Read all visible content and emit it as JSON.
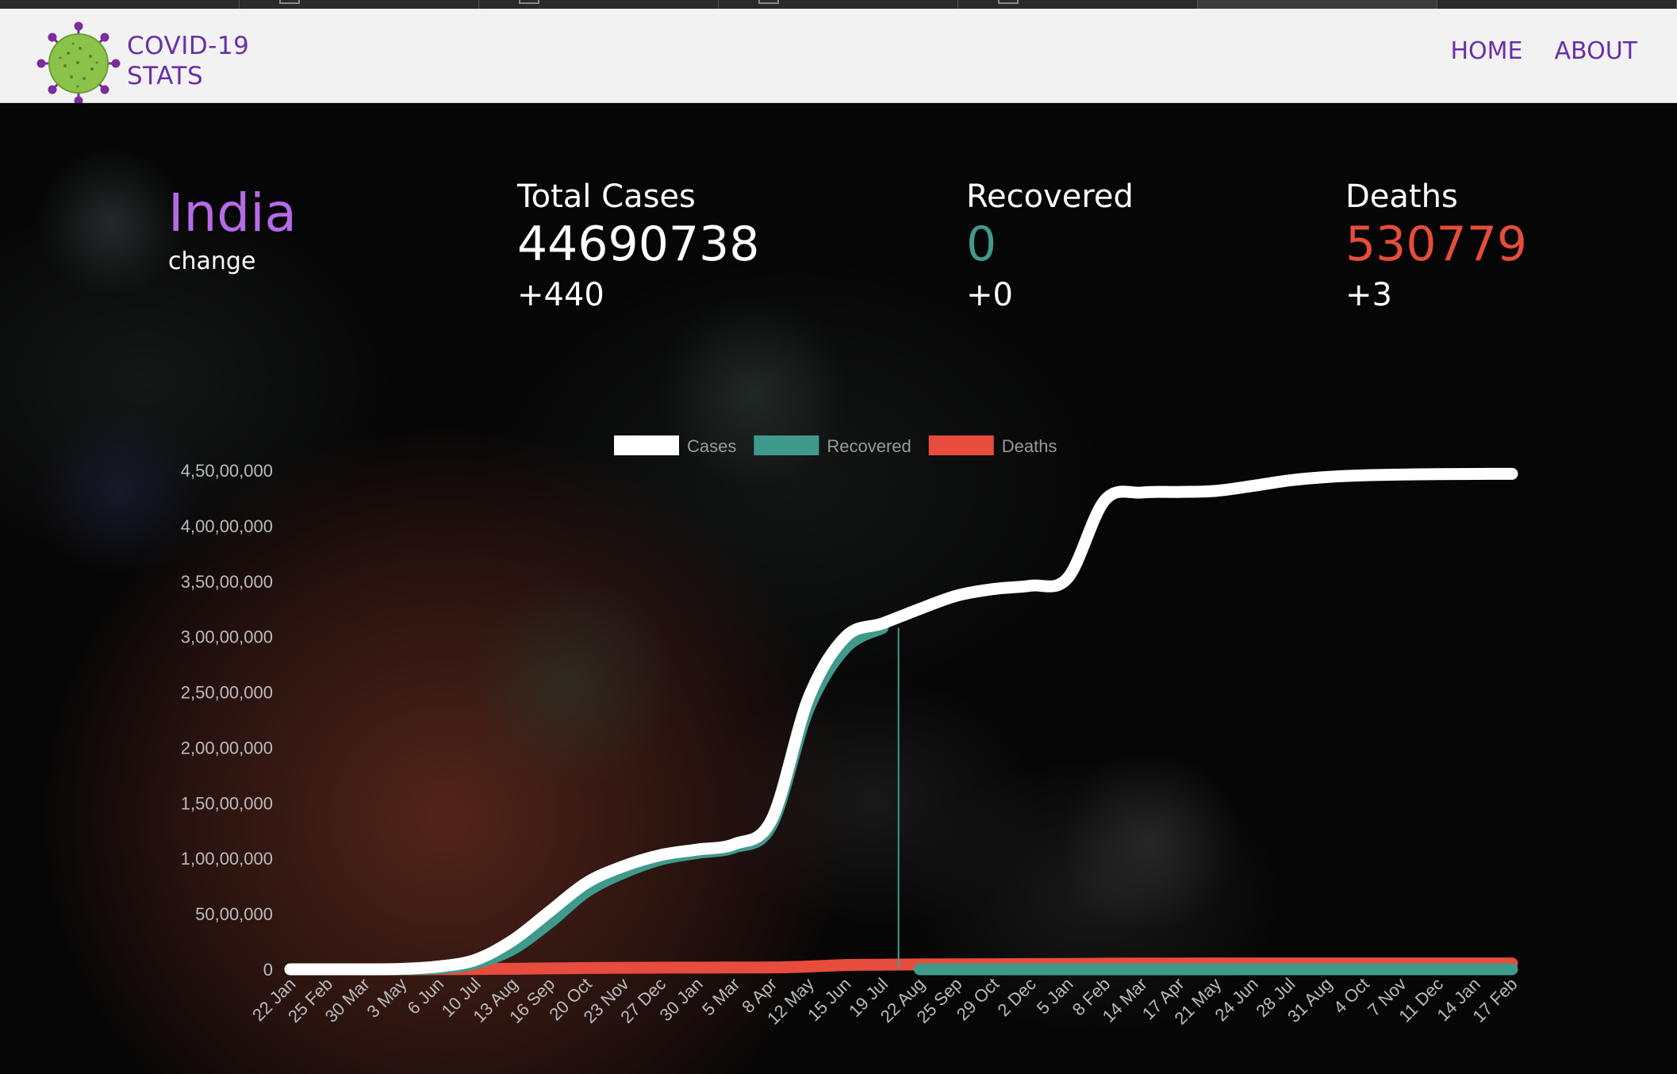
{
  "app": {
    "logo_line1": "COVID-19",
    "logo_line2": "STATS",
    "nav": {
      "home": "HOME",
      "about": "ABOUT"
    }
  },
  "country": {
    "name": "India",
    "change_label": "change"
  },
  "stats": {
    "cases": {
      "label": "Total Cases",
      "value": "44690738",
      "delta": "+440"
    },
    "recovered": {
      "label": "Recovered",
      "value": "0",
      "delta": "+0"
    },
    "deaths": {
      "label": "Deaths",
      "value": "530779",
      "delta": "+3"
    }
  },
  "colors": {
    "accent": "#6b2fa8",
    "country": "#b56be6",
    "cases": "#ffffff",
    "recovered": "#3f9a8c",
    "deaths": "#e74c3c"
  },
  "chart_data": {
    "type": "line",
    "legend_position": "top",
    "grid": false,
    "ylim": [
      0,
      45000000
    ],
    "yticks": [
      {
        "v": 0,
        "label": "0"
      },
      {
        "v": 5000000,
        "label": "50,00,000"
      },
      {
        "v": 10000000,
        "label": "1,00,00,000"
      },
      {
        "v": 15000000,
        "label": "1,50,00,000"
      },
      {
        "v": 20000000,
        "label": "2,00,00,000"
      },
      {
        "v": 25000000,
        "label": "2,50,00,000"
      },
      {
        "v": 30000000,
        "label": "3,00,00,000"
      },
      {
        "v": 35000000,
        "label": "3,50,00,000"
      },
      {
        "v": 40000000,
        "label": "4,00,00,000"
      },
      {
        "v": 45000000,
        "label": "4,50,00,000"
      }
    ],
    "categories": [
      "22 Jan",
      "25 Feb",
      "30 Mar",
      "3 May",
      "6 Jun",
      "10 Jul",
      "13 Aug",
      "16 Sep",
      "20 Oct",
      "23 Nov",
      "27 Dec",
      "30 Jan",
      "5 Mar",
      "8 Apr",
      "12 May",
      "15 Jun",
      "19 Jul",
      "22 Aug",
      "25 Sep",
      "29 Oct",
      "2 Dec",
      "5 Jan",
      "8 Feb",
      "14 Mar",
      "17 Apr",
      "21 May",
      "24 Jun",
      "28 Jul",
      "31 Aug",
      "4 Oct",
      "7 Nov",
      "11 Dec",
      "14 Jan",
      "17 Feb"
    ],
    "series": [
      {
        "name": "Cases",
        "color": "#ffffff",
        "values": [
          0,
          0,
          0,
          35000,
          250000,
          850000,
          2600000,
          5200000,
          7800000,
          9300000,
          10300000,
          10800000,
          11300000,
          13500000,
          24500000,
          30000000,
          31200000,
          32500000,
          33700000,
          34300000,
          34600000,
          35300000,
          42300000,
          43000000,
          43050000,
          43150000,
          43600000,
          44100000,
          44400000,
          44550000,
          44620000,
          44660000,
          44680000,
          44690738
        ]
      },
      {
        "name": "Recovered",
        "color": "#3f9a8c",
        "values": [
          0,
          0,
          0,
          10000,
          100000,
          550000,
          1800000,
          4200000,
          7000000,
          8700000,
          9900000,
          10500000,
          11000000,
          13000000,
          23500000,
          29000000,
          30800000,
          0,
          0,
          0,
          0,
          0,
          0,
          0,
          0,
          0,
          0,
          0,
          0,
          0,
          0,
          0,
          0,
          0
        ]
      },
      {
        "name": "Deaths",
        "color": "#e74c3c",
        "values": [
          0,
          0,
          0,
          1500,
          6500,
          23000,
          48000,
          82000,
          115000,
          135000,
          148000,
          154000,
          158000,
          166000,
          250000,
          385000,
          415000,
          437000,
          448000,
          458000,
          470000,
          482000,
          508000,
          516000,
          522000,
          524000,
          525000,
          526000,
          528000,
          529000,
          530000,
          530500,
          530700,
          530779
        ]
      }
    ]
  }
}
